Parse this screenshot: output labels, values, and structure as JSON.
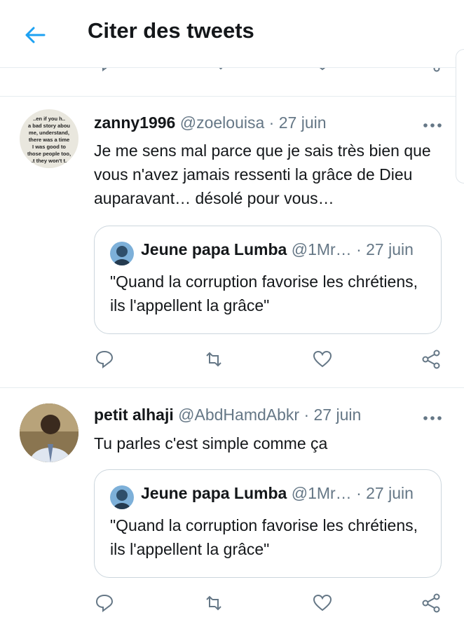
{
  "header": {
    "title": "Citer des tweets",
    "back_icon": "arrow-left-icon"
  },
  "accent_color": "#1da1f2",
  "tweets": [
    {
      "name": "zanny1996",
      "handle": "@zoelouisa",
      "sep": "·",
      "date": "27 juin",
      "avatar_text": [
        "..en if you h..",
        "a bad story abou",
        "me, understand,",
        "there was a time",
        "I was good to",
        "those people too,",
        "..t they won't t.."
      ],
      "text": "Je me sens mal parce que je sais très bien que vous n'avez jamais ressenti la grâce de Dieu auparavant… désolé pour vous…",
      "quote": {
        "name": "Jeune papa Lumba",
        "handle": "@1Mr…",
        "sep": "·",
        "date": "27 juin",
        "text": "\"Quand la corruption favorise les chrétiens, ils l'appellent la grâce\""
      }
    },
    {
      "name": "petit alhaji",
      "handle": "@AbdHamdAbkr",
      "sep": "·",
      "date": "27 juin",
      "text": "Tu parles c'est simple comme ça",
      "quote": {
        "name": "Jeune papa Lumba",
        "handle": "@1Mr…",
        "sep": "·",
        "date": "27 juin",
        "text": "\"Quand la corruption favorise les chrétiens, ils l'appellent la grâce\""
      }
    }
  ]
}
